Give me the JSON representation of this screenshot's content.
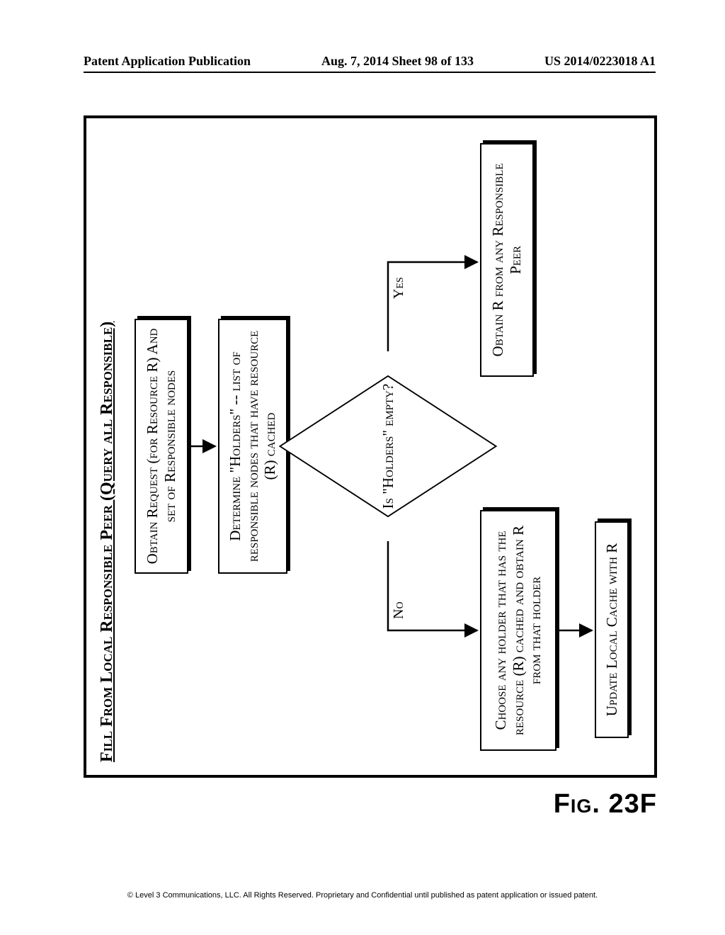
{
  "header": {
    "left": "Patent Application Publication",
    "center": "Aug. 7, 2014  Sheet 98 of 133",
    "right": "US 2014/0223018 A1"
  },
  "flow": {
    "title": "Fill From Local Responsible Peer (Query all Responsible)",
    "step_obtain_request": "Obtain Request (for Resource R) And set of Responsible nodes",
    "step_determine_holders": "Determine \"Holders\" -- list of responsible nodes that have resource (R) cached",
    "decision_holders_empty": "Is \"Holders\" empty?",
    "label_no": "No",
    "label_yes": "Yes",
    "step_choose_holder": "Choose any holder that has the resource (R) cached and obtain R from that holder",
    "step_update_cache": "Update Local Cache with R",
    "step_obtain_from_peer": "Obtain R from any Responsible Peer"
  },
  "figure_caption": "Fig. 23F",
  "footer": "© Level 3 Communications, LLC.  All Rights Reserved.  Proprietary and Confidential until published as patent application or issued patent."
}
